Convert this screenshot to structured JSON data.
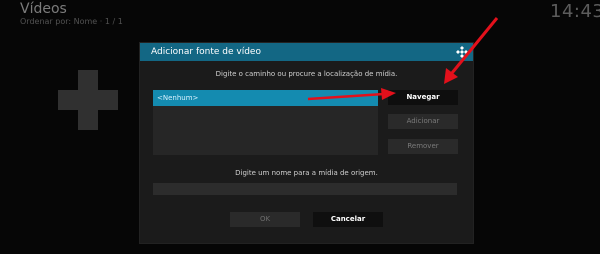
{
  "header": {
    "title": "Vídeos",
    "subtitle": "Ordenar por: Nome · 1 / 1",
    "clock": "14:43"
  },
  "dialog": {
    "title": "Adicionar fonte de vídeo",
    "path_instruction": "Digite o caminho ou procure a localização de mídia.",
    "path_value": "<Nenhum>",
    "buttons": {
      "browse": "Navegar",
      "add": "Adicionar",
      "remove": "Remover",
      "ok": "OK",
      "cancel": "Cancelar"
    },
    "name_instruction": "Digite um nome para a mídia de origem.",
    "name_value": ""
  },
  "colors": {
    "header_blue": "#136784",
    "selection_blue": "#148bb0",
    "annotation_red": "#e3101b"
  },
  "icons": [
    "plus-icon",
    "kodi-logo-icon",
    "arrow-annotation"
  ]
}
